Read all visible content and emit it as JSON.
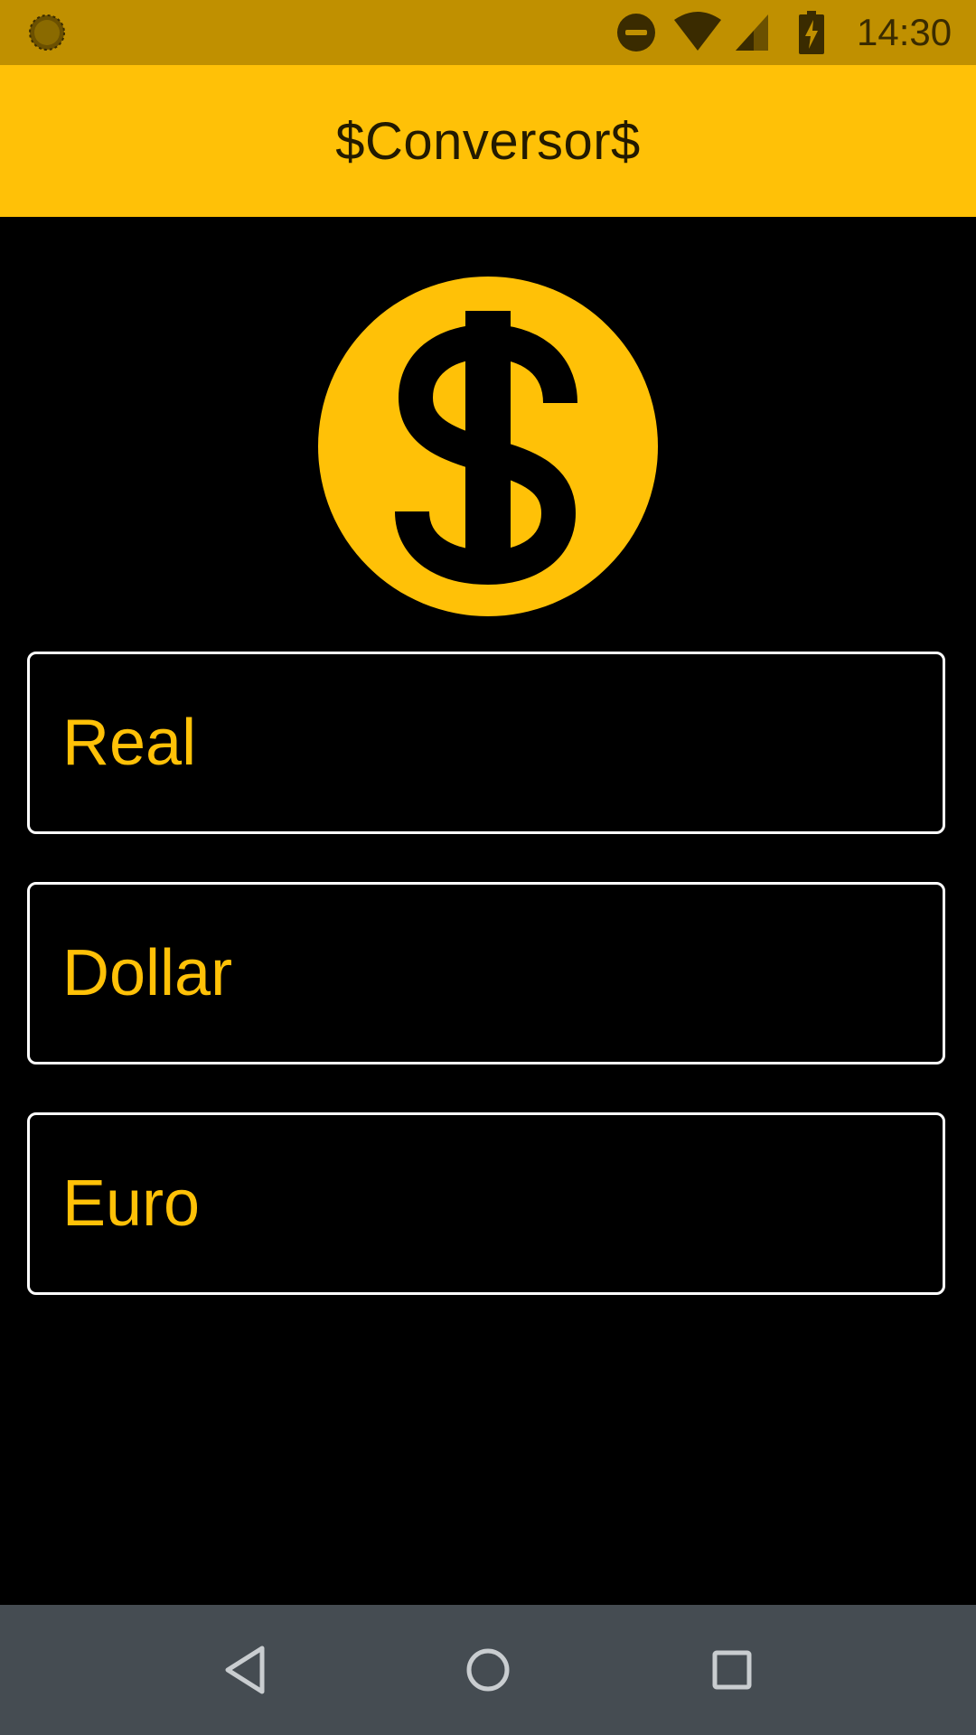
{
  "status_bar": {
    "time": "14:30",
    "icons": [
      "sync-icon",
      "do-not-disturb-icon",
      "wifi-icon",
      "signal-icon",
      "battery-charging-icon"
    ]
  },
  "app_bar": {
    "title": "$Conversor$"
  },
  "logo": {
    "icon": "dollar-coin-icon",
    "color": "#FFC107"
  },
  "fields": [
    {
      "label": "Real"
    },
    {
      "label": "Dollar"
    },
    {
      "label": "Euro"
    }
  ],
  "nav_bar": {
    "buttons": [
      "back-icon",
      "home-icon",
      "recents-icon"
    ]
  },
  "colors": {
    "accent": "#FFC107",
    "status_bar": "#C09000",
    "background": "#000000",
    "field_border": "#FFFFFF",
    "nav_bar": "#454C52"
  }
}
